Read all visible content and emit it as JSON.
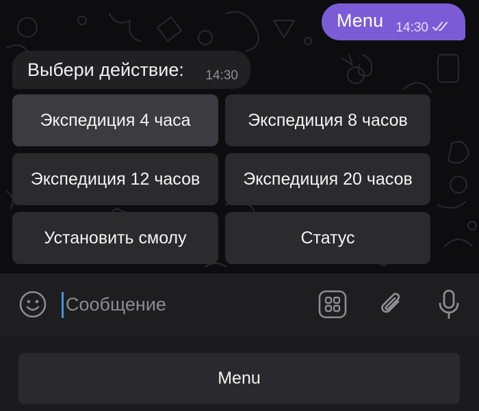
{
  "messages": {
    "outgoing": {
      "text": "Menu",
      "time": "14:30",
      "status_icon": "double-check-icon"
    },
    "incoming": {
      "text": "Выбери действие:",
      "time": "14:30"
    }
  },
  "inline_keyboard": {
    "rows": [
      [
        "Экспедиция 4 часа",
        "Экспедиция 8 часов"
      ],
      [
        "Экспедиция 12 часов",
        "Экспедиция 20 часов"
      ],
      [
        "Установить смолу",
        "Статус"
      ]
    ]
  },
  "input_bar": {
    "placeholder": "Сообщение",
    "icons": [
      "emoji-icon",
      "bot-commands-icon",
      "attach-icon",
      "mic-icon"
    ]
  },
  "reply_keyboard": {
    "button": "Menu"
  },
  "colors": {
    "accent": "#7b5cd6",
    "background": "#0d0d10",
    "bubble_in": "#212124",
    "keyboard_button": "#2b2b2e",
    "input_bar": "#1e1e21",
    "cursor": "#4d8fe0"
  }
}
